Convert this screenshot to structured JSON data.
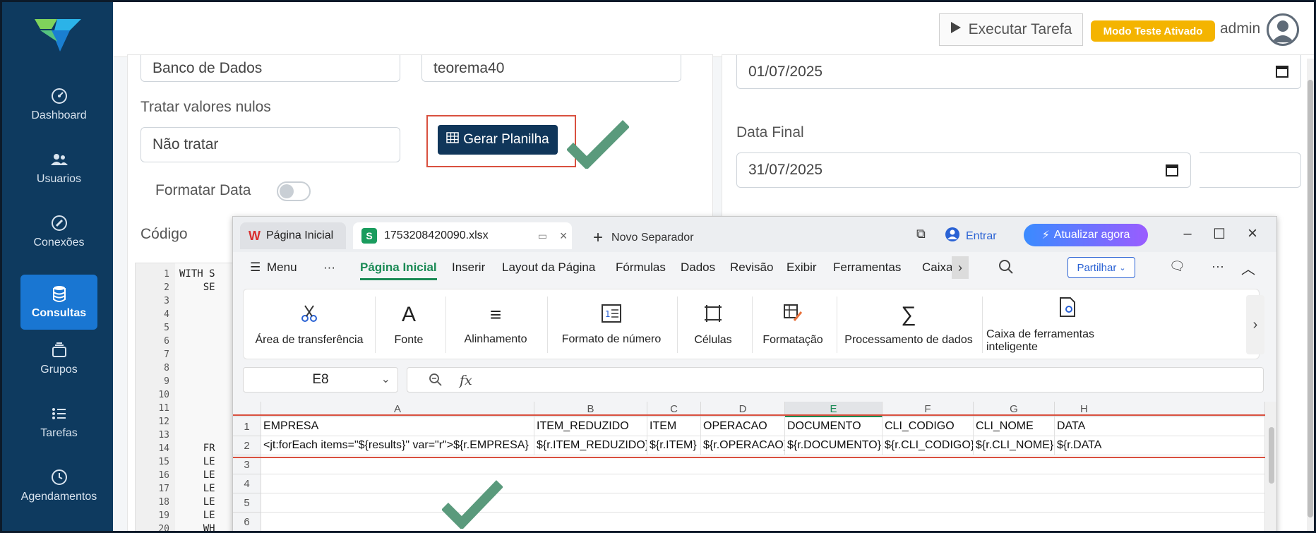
{
  "sidebar": {
    "items": [
      {
        "label": "Dashboard",
        "icon": "gauge-icon"
      },
      {
        "label": "Usuarios",
        "icon": "users-icon"
      },
      {
        "label": "Conexões",
        "icon": "plug-icon"
      },
      {
        "label": "Consultas",
        "icon": "database-icon",
        "active": true
      },
      {
        "label": "Grupos",
        "icon": "layers-icon"
      },
      {
        "label": "Tarefas",
        "icon": "list-icon"
      },
      {
        "label": "Agendamentos",
        "icon": "clock-icon"
      }
    ]
  },
  "header": {
    "execute_label": "Executar Tarefa",
    "test_mode_label": "Modo Teste Ativado",
    "user_label": "admin"
  },
  "form": {
    "db_type_value": "Banco de Dados",
    "db_name_value": "teorema40",
    "null_handling_label": "Tratar valores nulos",
    "null_handling_value": "Não tratar",
    "generate_button_label": "Gerar Planilha",
    "format_date_label": "Formatar Data",
    "code_label": "Código",
    "start_date_value": "01/07/2025",
    "end_date_label": "Data Final",
    "end_date_value": "31/07/2025"
  },
  "code_editor": {
    "line_numbers": "1\n2\n3\n4\n5\n6\n7\n8\n9\n10\n11\n12\n13\n14\n15\n16\n17\n18\n19\n20",
    "code_text": "WITH S\n    SE\n\n\n\n\n\n\n\n\n\n\n\n    FR\n    LE\n    LE\n    LE\n    LE\n    LE\n    WH"
  },
  "spreadsheet": {
    "tabs": [
      {
        "label": "Página Inicial"
      },
      {
        "label": "1753208420090.xlsx"
      }
    ],
    "new_tab_label": "Novo Separador",
    "signin_label": "Entrar",
    "update_label": "Atualizar agora",
    "menu_items": [
      "Menu",
      "···",
      "Página Inicial",
      "Inserir",
      "Layout da Página",
      "Fórmulas",
      "Dados",
      "Revisão",
      "Exibir",
      "Ferramentas",
      "Caixa"
    ],
    "share_label": "Partilhar",
    "ribbon": [
      {
        "label": "Área de transferência",
        "icon": "scissors-icon"
      },
      {
        "label": "Fonte",
        "icon": "font-icon"
      },
      {
        "label": "Alinhamento",
        "icon": "align-icon"
      },
      {
        "label": "Formato de número",
        "icon": "number-format-icon"
      },
      {
        "label": "Células",
        "icon": "cells-icon"
      },
      {
        "label": "Formatação",
        "icon": "format-icon"
      },
      {
        "label": "Processamento de dados",
        "icon": "sigma-icon"
      },
      {
        "label": "Caixa de ferramentas inteligente",
        "icon": "smart-toolbox-icon"
      }
    ],
    "name_box": "E8",
    "columns": [
      "A",
      "B",
      "C",
      "D",
      "E",
      "F",
      "G",
      "H"
    ],
    "rows": [
      "1",
      "2",
      "3",
      "4",
      "5",
      "6"
    ],
    "row1": [
      "EMPRESA",
      "ITEM_REDUZIDO",
      "ITEM",
      "OPERACAO",
      "DOCUMENTO",
      "CLI_CODIGO",
      "CLI_NOME",
      "DATA"
    ],
    "row2": [
      "<jt:forEach items=\"${results}\" var=\"r\">${r.EMPRESA}",
      "${r.ITEM_REDUZIDO}",
      "${r.ITEM}",
      "${r.OPERACAO}",
      "${r.DOCUMENTO}",
      "${r.CLI_CODIGO}",
      "${r.CLI_NOME}",
      "${r.DATA"
    ]
  },
  "colors": {
    "sidebar_bg": "#0e3a5f",
    "active_item": "#1976d2",
    "highlight_outline": "#d9503f",
    "check_mark": "#5a9a7c",
    "badge": "#f4b400",
    "sheet_green": "#1a8a55"
  }
}
